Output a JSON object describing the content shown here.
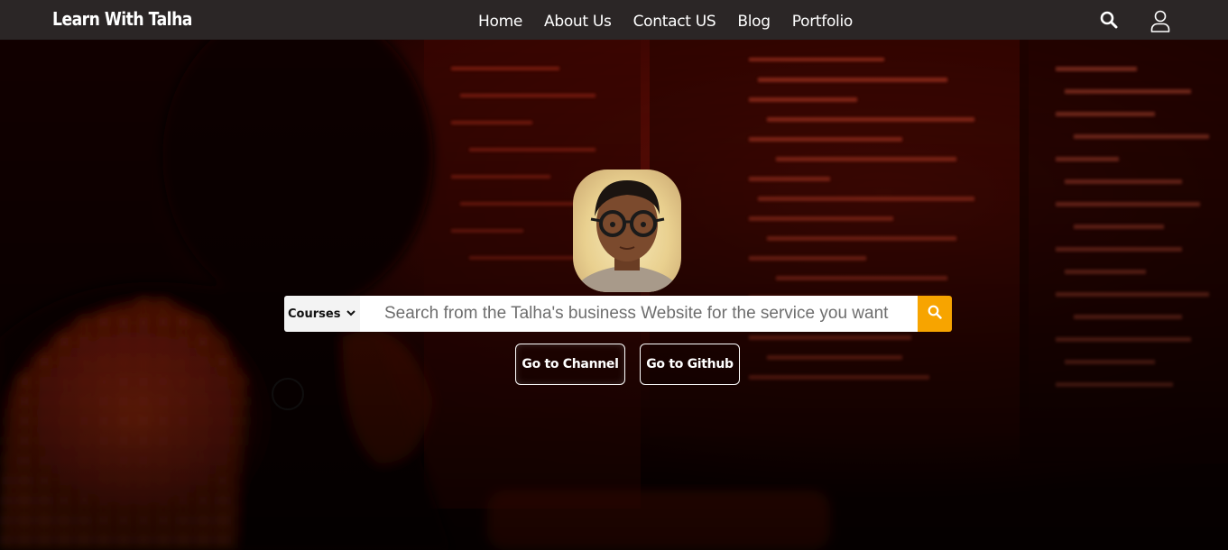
{
  "brand": "Learn With Talha",
  "nav": {
    "links": [
      "Home",
      "About Us",
      "Contact US",
      "Blog",
      "Portfolio"
    ],
    "icons": [
      "search-icon",
      "user-icon"
    ]
  },
  "hero": {
    "avatar": "profile-photo",
    "search": {
      "category": "Courses",
      "placeholder": "Search from the Talha's business Website for the service you want"
    },
    "buttons": {
      "channel": "Go to Channel",
      "github": "Go to Github"
    }
  },
  "colors": {
    "navbar": "#2b2626",
    "accent": "#f7a400",
    "hero_red": "#c41f10"
  }
}
